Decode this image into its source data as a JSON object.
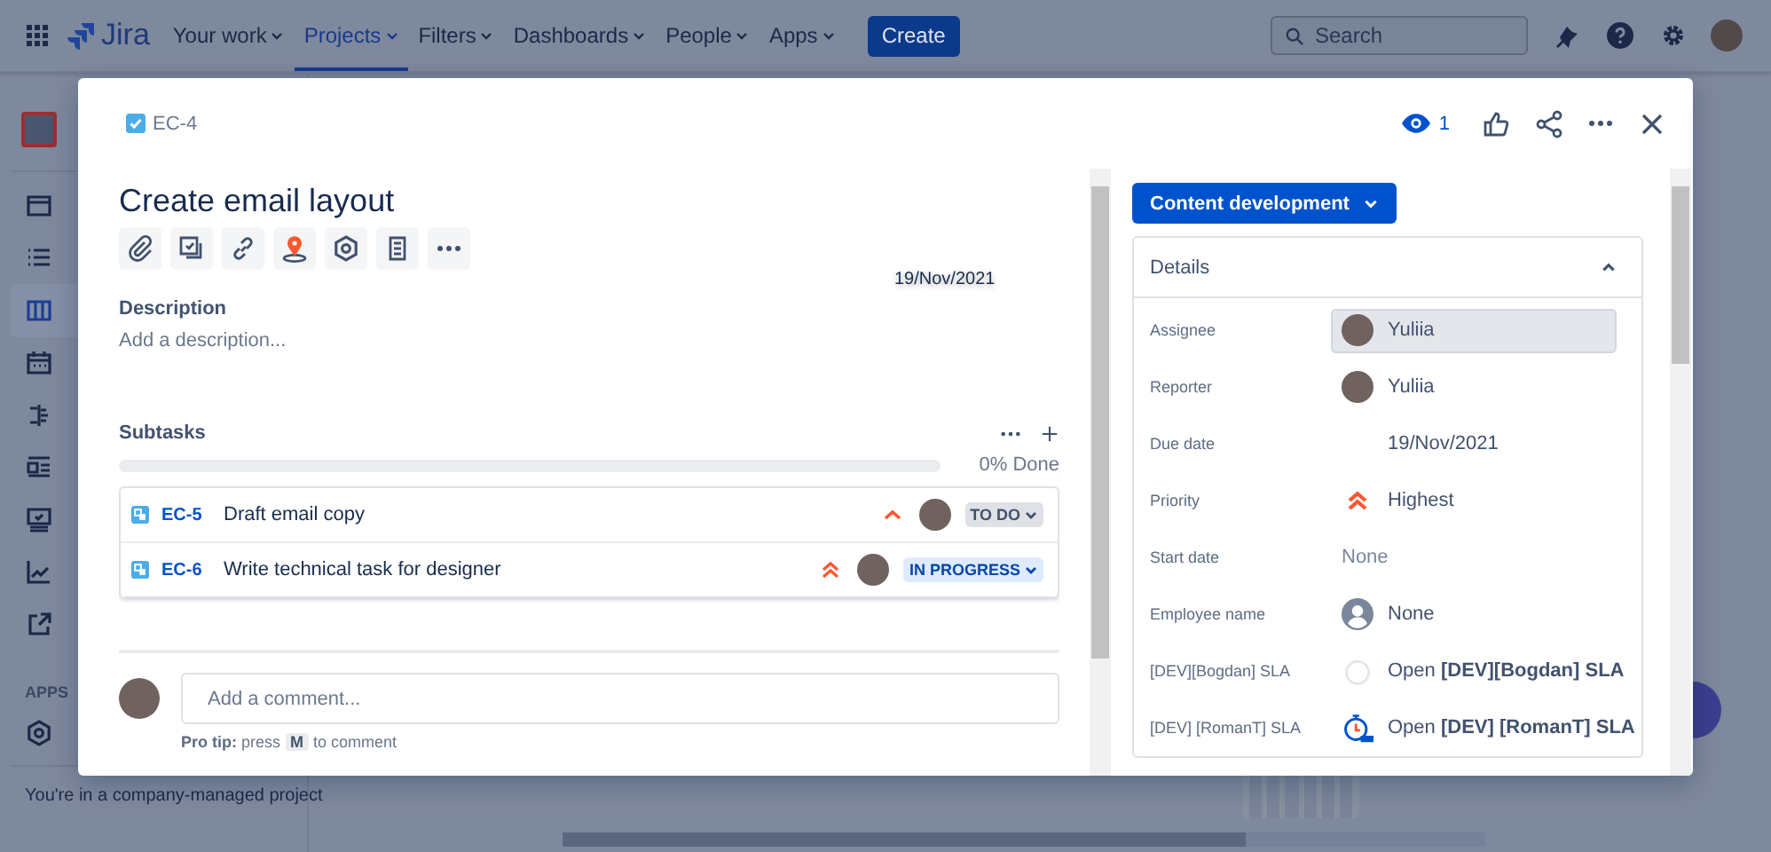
{
  "top_nav": {
    "product_name": "Jira",
    "items": [
      {
        "label": "Your work",
        "selected": false
      },
      {
        "label": "Projects",
        "selected": true
      },
      {
        "label": "Filters",
        "selected": false
      },
      {
        "label": "Dashboards",
        "selected": false
      },
      {
        "label": "People",
        "selected": false
      },
      {
        "label": "Apps",
        "selected": false
      }
    ],
    "create_button": "Create",
    "search": {
      "placeholder": "Search"
    }
  },
  "sidebar": {
    "items": [
      {
        "selected": false
      },
      {
        "selected": false
      },
      {
        "selected": true
      },
      {
        "selected": false
      },
      {
        "selected": false
      },
      {
        "selected": false
      },
      {
        "selected": false
      },
      {
        "selected": false
      },
      {
        "selected": false
      }
    ],
    "apps_label": "APPS",
    "footer": "You're in a company-managed project"
  },
  "issue": {
    "key": "EC-4",
    "watchers": "1",
    "title": "Create email layout",
    "date_hint": "19/Nov/2021",
    "description_label": "Description",
    "description_placeholder": "Add a description...",
    "subtasks": {
      "label": "Subtasks",
      "progress": {
        "level": 0,
        "reading": "0% Done"
      },
      "items": [
        {
          "key": "EC-5",
          "summary": "Draft email copy",
          "kind": "high",
          "status": "TO DO",
          "color": "#dfe1e6"
        },
        {
          "key": "EC-6",
          "summary": "Write technical task for designer",
          "kind": "highest",
          "status": "IN PROGRESS",
          "color": "#deebff"
        }
      ]
    },
    "comment": {
      "placeholder": "Add a comment...",
      "tip_label": "Pro tip:",
      "tip_before": "press",
      "tip_key": "M",
      "tip_after": "to comment"
    }
  },
  "status_button": "Content development",
  "details": {
    "title": "Details",
    "expanded": true,
    "fields": [
      {
        "label": "Assignee",
        "kind": "user",
        "value": "Yuliia",
        "highlighted": true
      },
      {
        "label": "Reporter",
        "kind": "user",
        "value": "Yuliia",
        "highlighted": false
      },
      {
        "label": "Due date",
        "kind": "text",
        "value": "19/Nov/2021",
        "highlighted": false
      },
      {
        "label": "Priority",
        "kind": "priority",
        "value": "Highest",
        "highlighted": false
      },
      {
        "label": "Start date",
        "kind": "empty",
        "value": "None",
        "highlighted": false
      },
      {
        "label": "Employee name",
        "kind": "nouser",
        "value": "None",
        "highlighted": false
      },
      {
        "label": "[DEV][Bogdan] SLA",
        "kind": "sla",
        "value": "Open **[DEV][Bogdan] SLA**",
        "highlighted": false
      },
      {
        "label": "[DEV] [RomanT] SLA",
        "kind": "sla_timer",
        "value": "Open **[DEV] [RomanT] SLA**",
        "highlighted": false
      }
    ]
  }
}
